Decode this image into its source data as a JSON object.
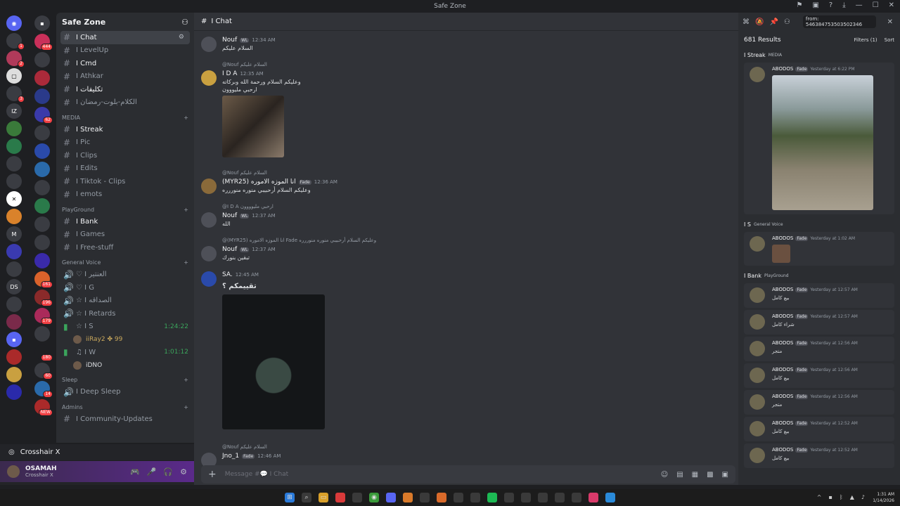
{
  "window": {
    "title": "Safe Zone"
  },
  "server_badges": [
    "1",
    "2",
    "3",
    "",
    "",
    "",
    "",
    "1",
    "1",
    "",
    "",
    "4",
    "",
    "",
    ""
  ],
  "server_badges2": [
    "444",
    "",
    "",
    "",
    "62",
    "",
    "",
    "",
    "1",
    "",
    "",
    "161",
    "196",
    "179",
    "",
    "",
    "180",
    "349",
    "60",
    "14",
    "NEW"
  ],
  "channels": {
    "guild_name": "Safe Zone",
    "items": [
      {
        "icon": "#",
        "label": "I Chat",
        "active": true
      },
      {
        "icon": "#",
        "label": "I LevelUp"
      },
      {
        "icon": "#",
        "label": "I Cmd",
        "unread": true
      },
      {
        "icon": "#",
        "label": "I Athkar"
      },
      {
        "icon": "#",
        "label": "I تكليفات",
        "unread": true
      },
      {
        "icon": "#",
        "label": "I الكلام-بلوت-رمضان"
      }
    ],
    "cat_media": "MEDIA",
    "media_items": [
      {
        "label": "I Streak",
        "unread": true
      },
      {
        "label": "I Pic"
      },
      {
        "label": "I Clips"
      },
      {
        "label": "I Edits"
      },
      {
        "label": "I Tiktok - Clips"
      },
      {
        "label": "I emots"
      }
    ],
    "cat_playground": "PlayGround",
    "playground_items": [
      {
        "label": "I Bank",
        "unread": true
      },
      {
        "label": "I Games"
      },
      {
        "label": "I Free-stuff"
      }
    ],
    "cat_voice": "General Voice",
    "voice_items": [
      {
        "label": "♡ I العنتير"
      },
      {
        "label": "♡ I G"
      },
      {
        "label": "☆ I الصداقه"
      },
      {
        "label": "☆ I Retards"
      },
      {
        "label": "☆ I S",
        "time": "1:24:22"
      },
      {
        "label": "♫ I W",
        "time": "1:01:12"
      }
    ],
    "voice_users": {
      "s_user": "iiRay2 ✤ 99",
      "w_user": "iDNO"
    },
    "cat_sleep": "Sleep",
    "sleep_item": "I Deep Sleep",
    "cat_admins": "Admins",
    "admins_item": "I Community-Updates"
  },
  "userpanel": {
    "activity": "Crosshair X",
    "username": "OSAMAH",
    "status": "Crosshair X"
  },
  "chat": {
    "channel": "I Chat",
    "composer_placeholder": "Message #💬 I Chat",
    "messages": [
      {
        "author": "Nouf",
        "tag": "WL",
        "time": "12:34 AM",
        "text": "السلام عليكم"
      },
      {
        "reply": "@Nouf السلام عليكم",
        "author": "I D A",
        "time": "12:35 AM",
        "text": "وعليكم السلام ورحمة الله وبركاته",
        "text2": "ارحبي مليووون"
      },
      {
        "reply": "@Nouf السلام عليكم",
        "author": "(MYR25) انا الموزه الاموره",
        "tag": "Fade",
        "time": "12:36 AM",
        "text": "وعليكم السلام أرحبيبي منوره منوررره"
      },
      {
        "reply": "@I D A ارحبي مليوووون",
        "author": "Nouf",
        "tag": "WL",
        "time": "12:37 AM",
        "text": "الله"
      },
      {
        "reply": "@(MYR25) انا الموزه الاموره Fade وعليكم السلام أرحبيبي منوره منوررره",
        "author": "Nouf",
        "tag": "WL",
        "time": "12:37 AM",
        "text": "تبقين بنورك"
      },
      {
        "author": "SA.",
        "time": "12:45 AM",
        "text": "تقييمكم ؟"
      },
      {
        "reply": "@Nouf السلام عليكم",
        "author": "Jno_1",
        "tag": "Fade",
        "time": "12:46 AM",
        "text": ""
      }
    ]
  },
  "search": {
    "query": "from: 546384753503502346",
    "results_count": "681 Results",
    "filters": "Filters (1)",
    "sort": "Sort",
    "sec_streak": "I Streak",
    "sec_streak_cat": "MEDIA",
    "sec_voice": "I S",
    "sec_voice_cat": "General Voice",
    "sec_bank": "I Bank",
    "sec_bank_cat": "PlayGround",
    "author": "ABODOS",
    "tag": "Fade",
    "results": [
      {
        "time": "Yesterday at 6:22 PM",
        "text": ""
      },
      {
        "time": "Yesterday at 1:02 AM",
        "text": ""
      },
      {
        "time": "Yesterday at 12:57 AM",
        "text": "بيع كامل"
      },
      {
        "time": "Yesterday at 12:57 AM",
        "text": "شراء كامل"
      },
      {
        "time": "Yesterday at 12:56 AM",
        "text": "متجر"
      },
      {
        "time": "Yesterday at 12:56 AM",
        "text": "بيع كامل"
      },
      {
        "time": "Yesterday at 12:56 AM",
        "text": "متجر"
      },
      {
        "time": "Yesterday at 12:52 AM",
        "text": "بيع كامل"
      },
      {
        "time": "Yesterday at 12:52 AM",
        "text": "بيع كامل"
      }
    ]
  },
  "taskbar": {
    "time": "1:31 AM",
    "date": "1/14/2026"
  }
}
